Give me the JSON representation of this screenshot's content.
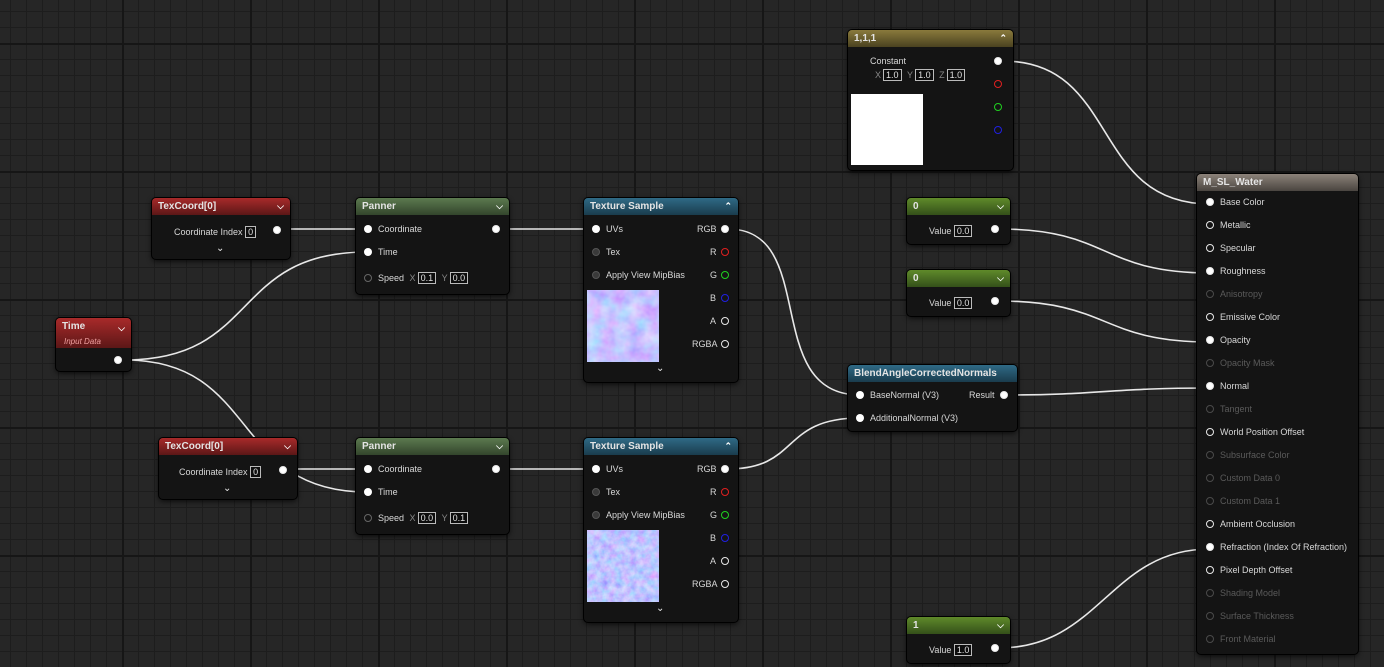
{
  "texcoord_a": {
    "title": "TexCoord[0]",
    "label": "Coordinate Index",
    "value": "0"
  },
  "texcoord_b": {
    "title": "TexCoord[0]",
    "label": "Coordinate Index",
    "value": "0"
  },
  "time": {
    "title": "Time",
    "subtitle": "Input Data"
  },
  "panner_a": {
    "title": "Panner",
    "coordinate": "Coordinate",
    "time": "Time",
    "speed": "Speed",
    "x_label": "X",
    "x": "0.1",
    "y_label": "Y",
    "y": "0.0"
  },
  "panner_b": {
    "title": "Panner",
    "coordinate": "Coordinate",
    "time": "Time",
    "speed": "Speed",
    "x_label": "X",
    "x": "0.0",
    "y_label": "Y",
    "y": "0.1"
  },
  "texsample_a": {
    "title": "Texture Sample",
    "uvs": "UVs",
    "tex": "Tex",
    "mip": "Apply View MipBias",
    "rgb": "RGB",
    "r": "R",
    "g": "G",
    "b": "B",
    "a": "A",
    "rgba": "RGBA"
  },
  "texsample_b": {
    "title": "Texture Sample",
    "uvs": "UVs",
    "tex": "Tex",
    "mip": "Apply View MipBias",
    "rgb": "RGB",
    "r": "R",
    "g": "G",
    "b": "B",
    "a": "A",
    "rgba": "RGBA"
  },
  "constant3": {
    "title": "1,1,1",
    "label": "Constant",
    "x_label": "X",
    "x": "1.0",
    "y_label": "Y",
    "y": "1.0",
    "z_label": "Z",
    "z": "1.0"
  },
  "scalar_a": {
    "title": "0",
    "label": "Value",
    "value": "0.0"
  },
  "scalar_b": {
    "title": "0",
    "label": "Value",
    "value": "0.0"
  },
  "scalar_c": {
    "title": "1",
    "label": "Value",
    "value": "1.0"
  },
  "blend": {
    "title": "BlendAngleCorrectedNormals",
    "base": "BaseNormal (V3)",
    "additional": "AdditionalNormal (V3)",
    "result": "Result"
  },
  "material": {
    "title": "M_SL_Water",
    "pins": [
      {
        "label": "Base Color",
        "enabled": true,
        "connected": true
      },
      {
        "label": "Metallic",
        "enabled": true,
        "connected": false
      },
      {
        "label": "Specular",
        "enabled": true,
        "connected": false
      },
      {
        "label": "Roughness",
        "enabled": true,
        "connected": true
      },
      {
        "label": "Anisotropy",
        "enabled": false,
        "connected": false
      },
      {
        "label": "Emissive Color",
        "enabled": true,
        "connected": false
      },
      {
        "label": "Opacity",
        "enabled": true,
        "connected": true
      },
      {
        "label": "Opacity Mask",
        "enabled": false,
        "connected": false
      },
      {
        "label": "Normal",
        "enabled": true,
        "connected": true
      },
      {
        "label": "Tangent",
        "enabled": false,
        "connected": false
      },
      {
        "label": "World Position Offset",
        "enabled": true,
        "connected": false
      },
      {
        "label": "Subsurface Color",
        "enabled": false,
        "connected": false
      },
      {
        "label": "Custom Data 0",
        "enabled": false,
        "connected": false
      },
      {
        "label": "Custom Data 1",
        "enabled": false,
        "connected": false
      },
      {
        "label": "Ambient Occlusion",
        "enabled": true,
        "connected": false
      },
      {
        "label": "Refraction (Index Of Refraction)",
        "enabled": true,
        "connected": true
      },
      {
        "label": "Pixel Depth Offset",
        "enabled": true,
        "connected": false
      },
      {
        "label": "Shading Model",
        "enabled": false,
        "connected": false
      },
      {
        "label": "Surface Thickness",
        "enabled": false,
        "connected": false
      },
      {
        "label": "Front Material",
        "enabled": false,
        "connected": false
      }
    ]
  },
  "colors": {
    "wire": "#e8e8e8",
    "background": "#262626",
    "red_pin": "#e02020",
    "green_pin": "#20d020",
    "blue_pin": "#2020e0"
  },
  "icons": {
    "collapse": "chevron-up-icon",
    "expand": "chevron-down-icon"
  }
}
